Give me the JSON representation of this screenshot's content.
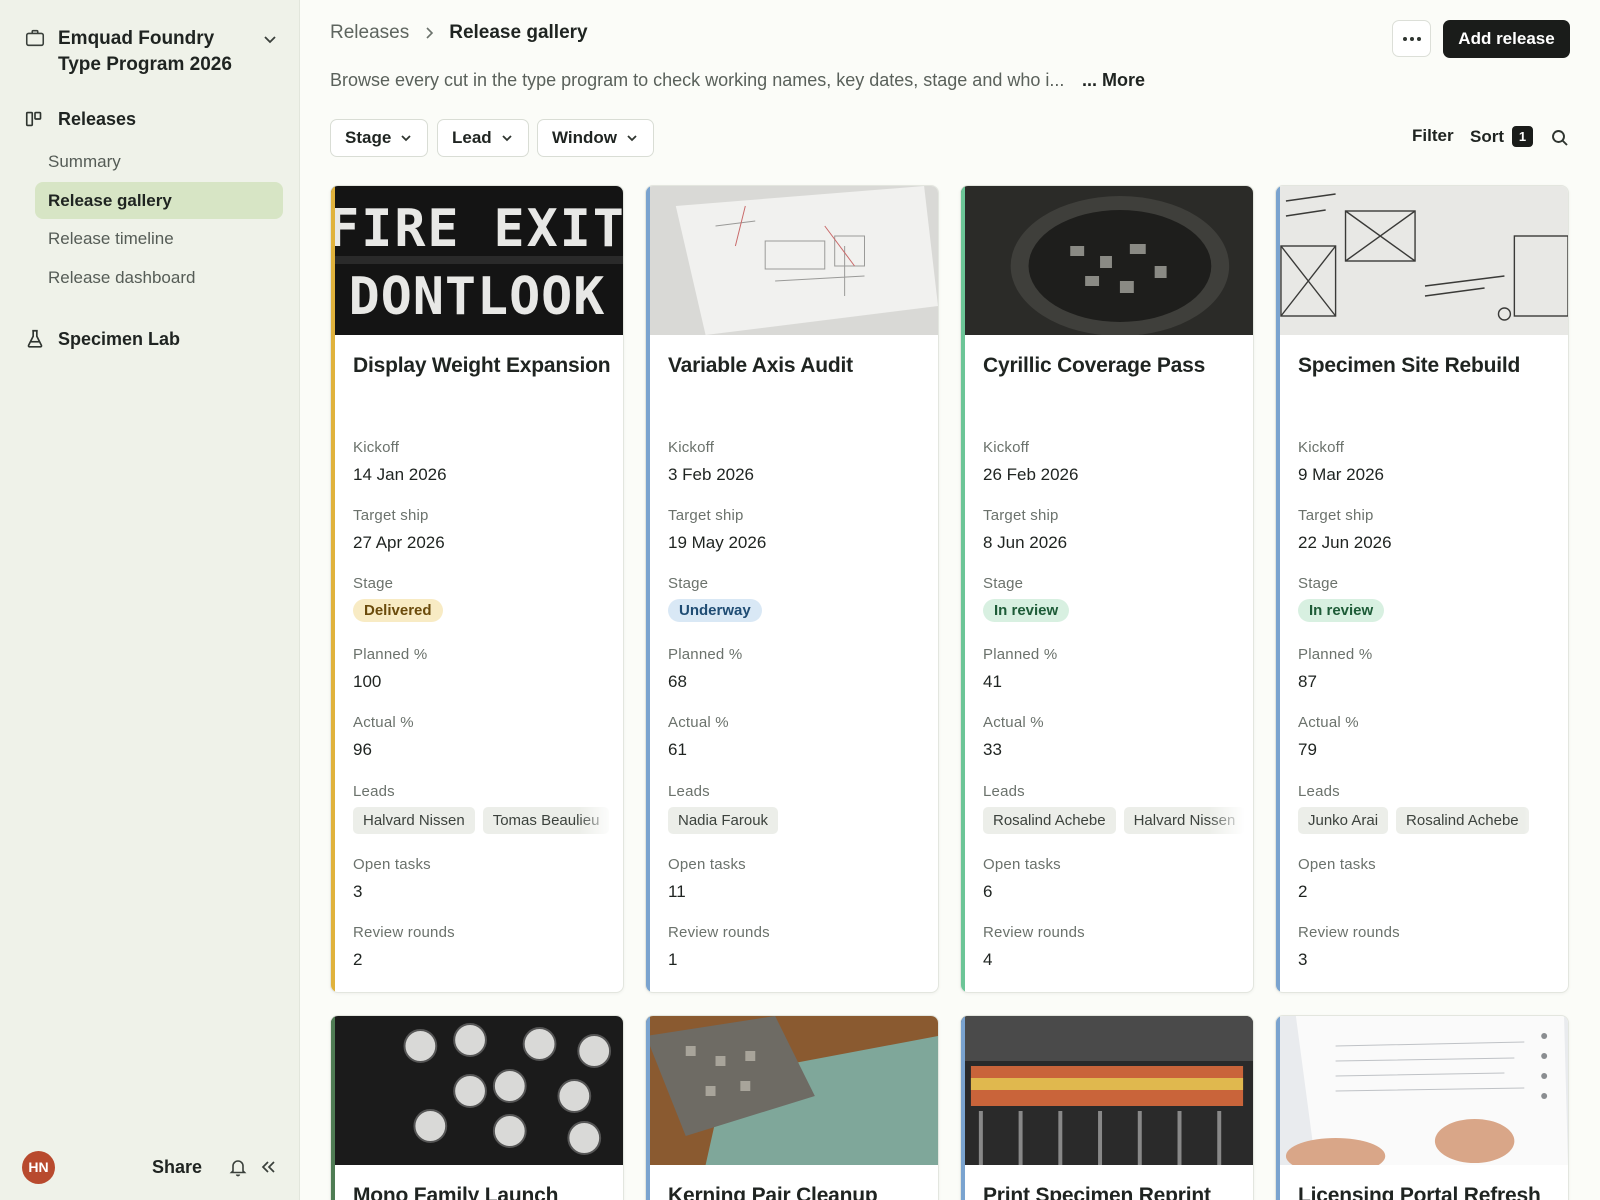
{
  "workspace": {
    "name": "Emquad Foundry Type Program 2026"
  },
  "sidebar": {
    "section_releases": "Releases",
    "items": [
      {
        "label": "Summary",
        "active": false
      },
      {
        "label": "Release gallery",
        "active": true
      },
      {
        "label": "Release timeline",
        "active": false
      },
      {
        "label": "Release dashboard",
        "active": false
      }
    ],
    "section_lab": "Specimen Lab",
    "footer": {
      "avatar_initials": "HN",
      "share_label": "Share"
    }
  },
  "header": {
    "breadcrumb_parent": "Releases",
    "breadcrumb_current": "Release gallery",
    "add_button": "Add release",
    "description": "Browse every cut in the type program to check working names, key dates, stage and who i...",
    "more_link": "... More"
  },
  "filters": {
    "chips": [
      "Stage",
      "Lead",
      "Window"
    ],
    "filter_label": "Filter",
    "sort_label": "Sort",
    "sort_count": "1"
  },
  "field_labels": {
    "kickoff": "Kickoff",
    "target": "Target ship",
    "stage": "Stage",
    "planned": "Planned %",
    "actual": "Actual %",
    "leads": "Leads",
    "open_tasks": "Open tasks",
    "review_rounds": "Review rounds"
  },
  "cards": [
    {
      "title": "Display Weight Expansion",
      "kickoff": "14 Jan 2026",
      "target": "27 Apr 2026",
      "stage": "Delivered",
      "stage_color": "#f8ebc4",
      "stage_text": "#6b4b0c",
      "accent": "#e0b23c",
      "planned": "100",
      "actual": "96",
      "leads": [
        "Halvard Nissen",
        "Tomas Beaulieu"
      ],
      "open_tasks": "3",
      "review_rounds": "2",
      "cover_icon": "fire-exit-sign-photo"
    },
    {
      "title": "Variable Axis Audit",
      "kickoff": "3 Feb 2026",
      "target": "19 May 2026",
      "stage": "Underway",
      "stage_color": "#d9e8f5",
      "stage_text": "#1f4c73",
      "accent": "#7aa3cf",
      "planned": "68",
      "actual": "61",
      "leads": [
        "Nadia Farouk"
      ],
      "open_tasks": "11",
      "review_rounds": "1",
      "cover_icon": "sketch-paper-photo"
    },
    {
      "title": "Cyrillic Coverage Pass",
      "kickoff": "26 Feb 2026",
      "target": "8 Jun 2026",
      "stage": "In review",
      "stage_color": "#d8f0e1",
      "stage_text": "#1d5b37",
      "accent": "#6cc597",
      "planned": "41",
      "actual": "33",
      "leads": [
        "Rosalind Achebe",
        "Halvard Nissen"
      ],
      "open_tasks": "6",
      "review_rounds": "4",
      "cover_icon": "metal-type-bowl-photo"
    },
    {
      "title": "Specimen Site Rebuild",
      "kickoff": "9 Mar 2026",
      "target": "22 Jun 2026",
      "stage": "In review",
      "stage_color": "#d8f0e1",
      "stage_text": "#1d5b37",
      "accent": "#7aa3cf",
      "planned": "87",
      "actual": "79",
      "leads": [
        "Junko Arai",
        "Rosalind Achebe"
      ],
      "open_tasks": "2",
      "review_rounds": "3",
      "cover_icon": "wireframe-sketch-photo"
    }
  ],
  "cards_row2": [
    {
      "title": "Mono Family Launch",
      "accent": "#4f7c54",
      "cover_icon": "typewriter-keys-photo"
    },
    {
      "title": "Kerning Pair Cleanup",
      "accent": "#7aa3cf",
      "cover_icon": "wood-type-photo"
    },
    {
      "title": "Print Specimen Reprint",
      "accent": "#7aa3cf",
      "cover_icon": "printing-press-photo"
    },
    {
      "title": "Licensing Portal Refresh",
      "accent": "#7aa3cf",
      "cover_icon": "notebook-writing-photo"
    }
  ]
}
